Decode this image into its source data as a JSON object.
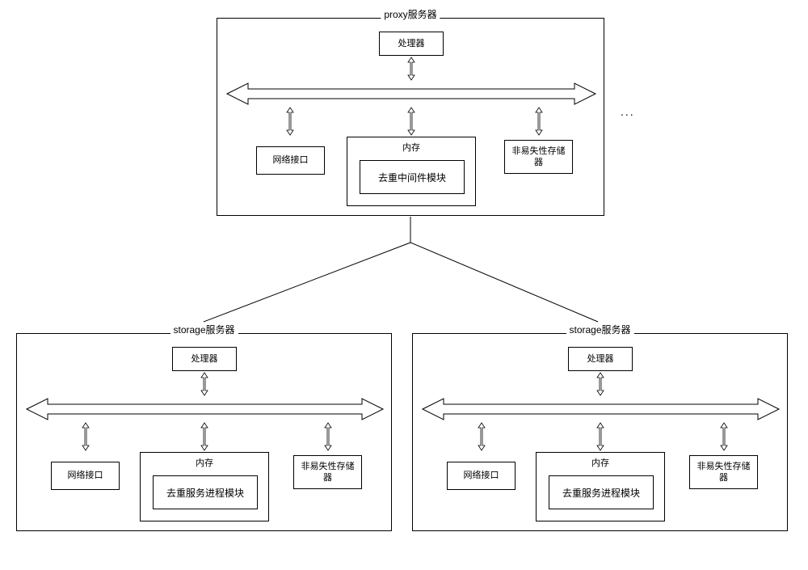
{
  "proxy": {
    "title": "proxy服务器",
    "processor": "处理器",
    "network": "网络接口",
    "memory_label": "内存",
    "module": "去重中间件模块",
    "storage": "非易失性存储器"
  },
  "storage1": {
    "title": "storage服务器",
    "processor": "处理器",
    "network": "网络接口",
    "memory_label": "内存",
    "module": "去重服务进程模块",
    "storage": "非易失性存储器"
  },
  "storage2": {
    "title": "storage服务器",
    "processor": "处理器",
    "network": "网络接口",
    "memory_label": "内存",
    "module": "去重服务进程模块",
    "storage": "非易失性存储器"
  },
  "ellipsis": "..."
}
